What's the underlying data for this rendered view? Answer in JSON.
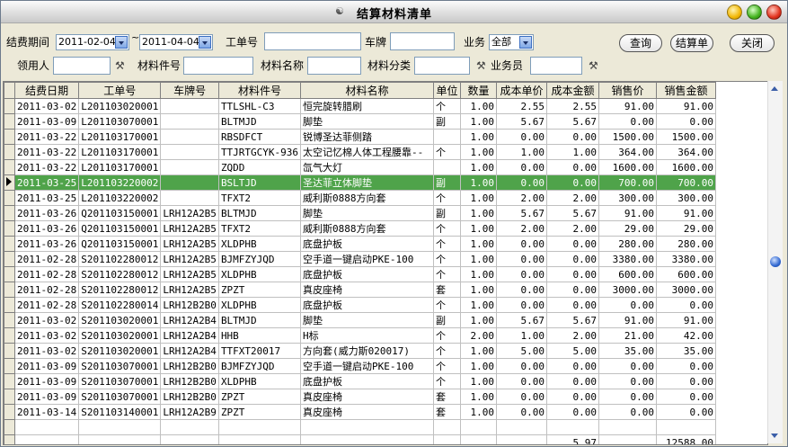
{
  "window": {
    "title": "结算材料清单"
  },
  "filters": {
    "period_label": "结费期间",
    "date_from": "2011-02-04",
    "date_sep": "~",
    "date_to": "2011-04-04",
    "order_label": "工单号",
    "order_value": "",
    "plate_label": "车牌",
    "plate_value": "",
    "business_label": "业务",
    "business_value": "全部",
    "receiver_label": "领用人",
    "receiver_value": "",
    "part_no_label": "材料件号",
    "part_no_value": "",
    "part_name_label": "材料名称",
    "part_name_value": "",
    "category_label": "材料分类",
    "category_value": "",
    "staff_label": "业务员",
    "staff_value": ""
  },
  "buttons": {
    "query": "查询",
    "settle": "结算单",
    "close": "关闭"
  },
  "table": {
    "columns": [
      "结费日期",
      "工单号",
      "车牌号",
      "材料件号",
      "材料名称",
      "单位",
      "数量",
      "成本单价",
      "成本金额",
      "销售价",
      "销售金额"
    ],
    "selected_row": 5,
    "rows": [
      [
        "2011-03-02",
        "L201103020001",
        "",
        "TTLSHL-C3",
        "恒完旋转腊刷",
        "个",
        "1.00",
        "2.55",
        "2.55",
        "91.00",
        "91.00"
      ],
      [
        "2011-03-09",
        "L201103070001",
        "",
        "BLTMJD",
        "脚垫",
        "副",
        "1.00",
        "5.67",
        "5.67",
        "0.00",
        "0.00"
      ],
      [
        "2011-03-22",
        "L201103170001",
        "",
        "RBSDFCT",
        "锐博圣达菲侧踏",
        "",
        "1.00",
        "0.00",
        "0.00",
        "1500.00",
        "1500.00"
      ],
      [
        "2011-03-22",
        "L201103170001",
        "",
        "TTJRTGCYK-936",
        "太空记忆棉人体工程腰靠--",
        "个",
        "1.00",
        "1.00",
        "1.00",
        "364.00",
        "364.00"
      ],
      [
        "2011-03-22",
        "L201103170001",
        "",
        "ZQDD",
        "氙气大灯",
        "",
        "1.00",
        "0.00",
        "0.00",
        "1600.00",
        "1600.00"
      ],
      [
        "2011-03-25",
        "L201103220002",
        "",
        "BSLTJD",
        "圣达菲立体脚垫",
        "副",
        "1.00",
        "0.00",
        "0.00",
        "700.00",
        "700.00"
      ],
      [
        "2011-03-25",
        "L201103220002",
        "",
        "TFXT2",
        "威利斯0888方向套",
        "个",
        "1.00",
        "2.00",
        "2.00",
        "300.00",
        "300.00"
      ],
      [
        "2011-03-26",
        "Q201103150001",
        "LRH12A2B5",
        "BLTMJD",
        "脚垫",
        "副",
        "1.00",
        "5.67",
        "5.67",
        "91.00",
        "91.00"
      ],
      [
        "2011-03-26",
        "Q201103150001",
        "LRH12A2B5",
        "TFXT2",
        "威利斯0888方向套",
        "个",
        "1.00",
        "2.00",
        "2.00",
        "29.00",
        "29.00"
      ],
      [
        "2011-03-26",
        "Q201103150001",
        "LRH12A2B5",
        "XLDPHB",
        "底盘护板",
        "个",
        "1.00",
        "0.00",
        "0.00",
        "280.00",
        "280.00"
      ],
      [
        "2011-02-28",
        "S201102280012",
        "LRH12A2B5",
        "BJMFZYJQD",
        "空手道一键启动PKE-100",
        "个",
        "1.00",
        "0.00",
        "0.00",
        "3380.00",
        "3380.00"
      ],
      [
        "2011-02-28",
        "S201102280012",
        "LRH12A2B5",
        "XLDPHB",
        "底盘护板",
        "个",
        "1.00",
        "0.00",
        "0.00",
        "600.00",
        "600.00"
      ],
      [
        "2011-02-28",
        "S201102280012",
        "LRH12A2B5",
        "ZPZT",
        "真皮座椅",
        "套",
        "1.00",
        "0.00",
        "0.00",
        "3000.00",
        "3000.00"
      ],
      [
        "2011-02-28",
        "S201102280014",
        "LRH12B2B0",
        "XLDPHB",
        "底盘护板",
        "个",
        "1.00",
        "0.00",
        "0.00",
        "0.00",
        "0.00"
      ],
      [
        "2011-03-02",
        "S201103020001",
        "LRH12A2B4",
        "BLTMJD",
        "脚垫",
        "副",
        "1.00",
        "5.67",
        "5.67",
        "91.00",
        "91.00"
      ],
      [
        "2011-03-02",
        "S201103020001",
        "LRH12A2B4",
        "HHB",
        "H标",
        "个",
        "2.00",
        "1.00",
        "2.00",
        "21.00",
        "42.00"
      ],
      [
        "2011-03-02",
        "S201103020001",
        "LRH12A2B4",
        "TTFXT20017",
        "方向套(威力斯020017)",
        "个",
        "1.00",
        "5.00",
        "5.00",
        "35.00",
        "35.00"
      ],
      [
        "2011-03-09",
        "S201103070001",
        "LRH12B2B0",
        "BJMFZYJQD",
        "空手道一键启动PKE-100",
        "个",
        "1.00",
        "0.00",
        "0.00",
        "0.00",
        "0.00"
      ],
      [
        "2011-03-09",
        "S201103070001",
        "LRH12B2B0",
        "XLDPHB",
        "底盘护板",
        "个",
        "1.00",
        "0.00",
        "0.00",
        "0.00",
        "0.00"
      ],
      [
        "2011-03-09",
        "S201103070001",
        "LRH12B2B0",
        "ZPZT",
        "真皮座椅",
        "套",
        "1.00",
        "0.00",
        "0.00",
        "0.00",
        "0.00"
      ],
      [
        "2011-03-14",
        "S201103140001",
        "LRH12A2B9",
        "ZPZT",
        "真皮座椅",
        "套",
        "1.00",
        "0.00",
        "0.00",
        "0.00",
        "0.00"
      ]
    ],
    "totals": [
      "",
      "",
      "",
      "",
      "",
      "",
      "",
      "",
      "5.97",
      "",
      "12588.00"
    ]
  }
}
